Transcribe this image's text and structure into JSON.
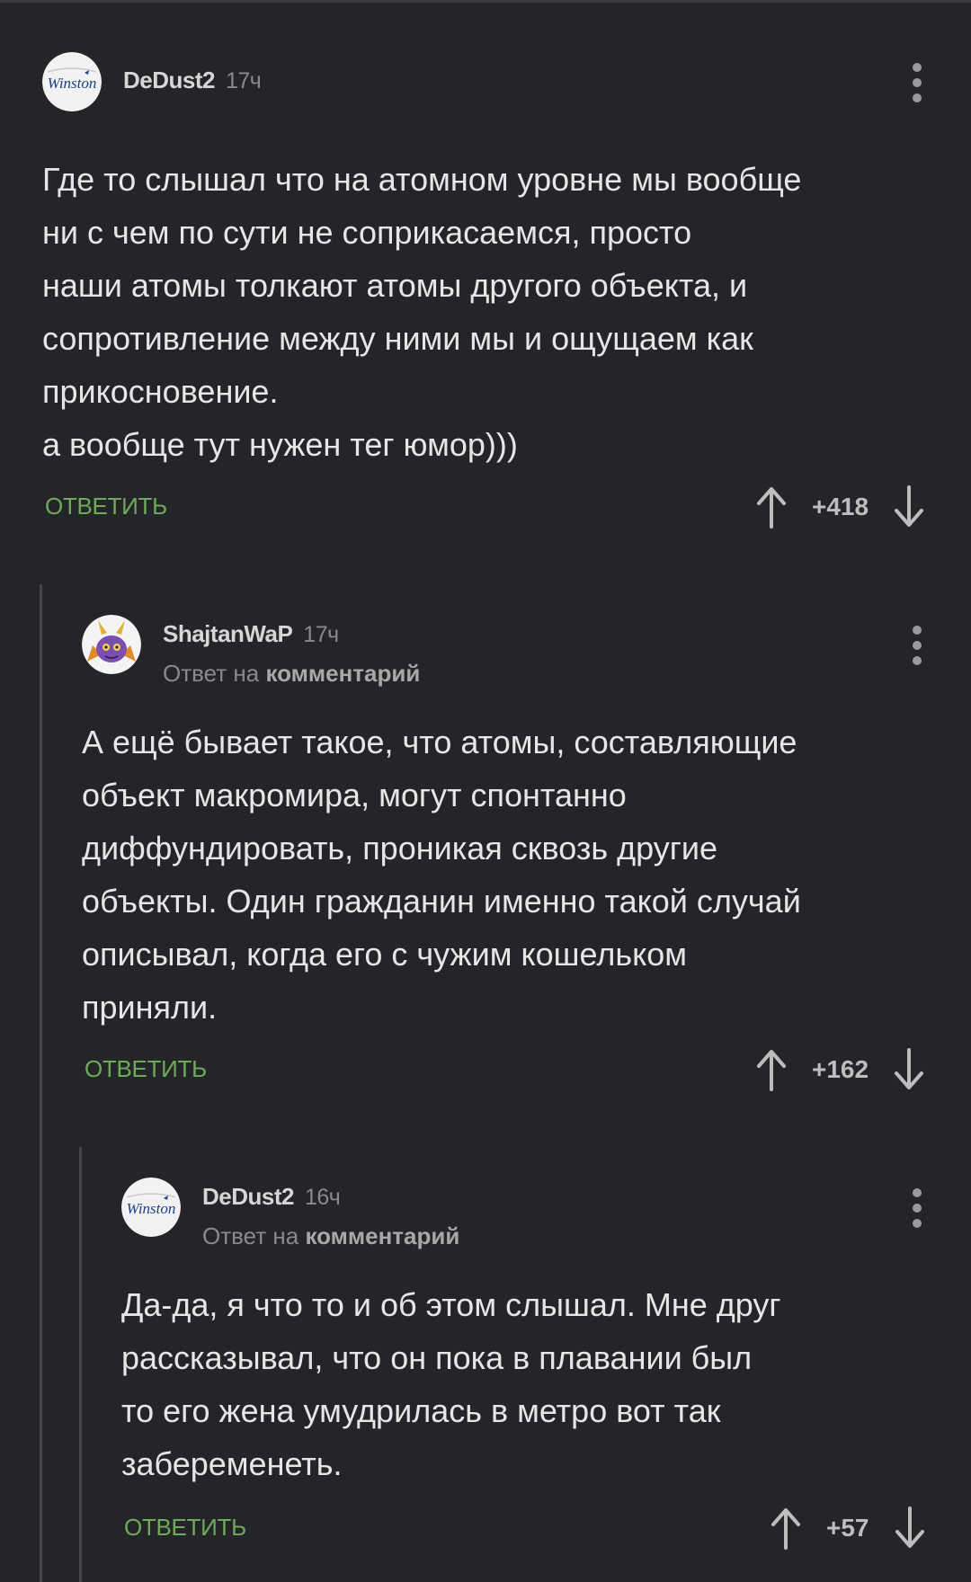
{
  "comments": [
    {
      "author": "DeDust2",
      "time": "17ч",
      "avatar_text": "Winston",
      "text": "Где то слышал что на атомном уровне мы вообще\nни с чем по сути не соприкасаемся, просто\nнаши атомы толкают атомы другого объекта, и\nсопротивление между ними мы и ощущаем как\nприкосновение.\nа вообще тут нужен тег юмор)))",
      "reply_label": "ОТВЕТИТЬ",
      "score": "+418"
    },
    {
      "author": "ShajtanWaP",
      "time": "17ч",
      "reply_to_prefix": "Ответ на",
      "reply_to_link": "комментарий",
      "text": "А ещё бывает такое, что атомы, составляющие\nобъект макромира, могут спонтанно\nдиффундировать, проникая сквозь другие\nобъекты. Один гражданин именно такой случай\nописывал, когда его с чужим кошельком\nприняли.",
      "reply_label": "ОТВЕТИТЬ",
      "score": "+162"
    },
    {
      "author": "DeDust2",
      "time": "16ч",
      "avatar_text": "Winston",
      "reply_to_prefix": "Ответ на",
      "reply_to_link": "комментарий",
      "text": "Да-да, я что то и об этом слышал. Мне друг\nрассказывал, что он пока в плавании был\nто его жена умудрилась в метро вот так\nзабеременеть.",
      "reply_label": "ОТВЕТИТЬ",
      "score": "+57"
    }
  ],
  "colors": {
    "background": "#232528",
    "reply_button": "#6fa95a",
    "thread_line": "#44464a"
  }
}
